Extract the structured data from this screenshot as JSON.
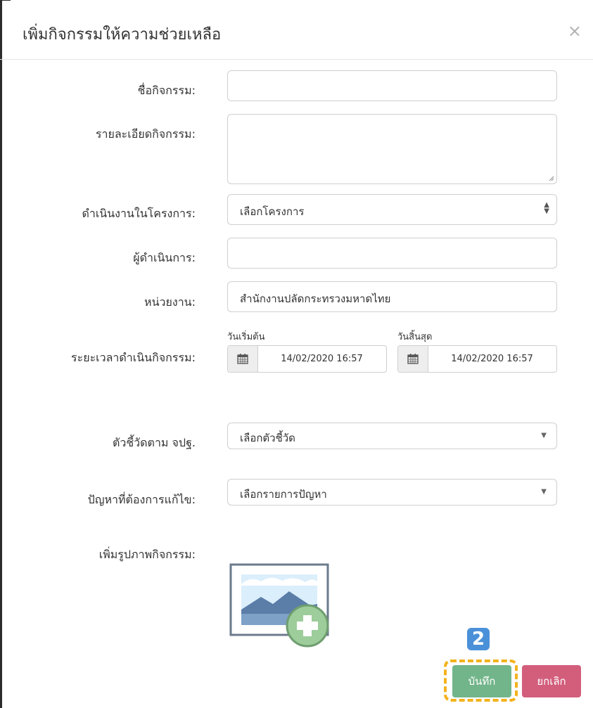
{
  "modal": {
    "title": "เพิ่มกิจกรรมให้ความช่วยเหลือ",
    "close_symbol": "×"
  },
  "form": {
    "activity_name": {
      "label": "ชื่อกิจกรรม:",
      "value": ""
    },
    "activity_detail": {
      "label": "รายละเอียดกิจกรรม:",
      "value": ""
    },
    "project": {
      "label": "ดำเนินงานในโครงการ:",
      "selected": "เลือกโครงการ"
    },
    "operator": {
      "label": "ผู้ดำเนินการ:",
      "value": ""
    },
    "agency": {
      "label": "หน่วยงาน:",
      "value": "สำนักงานปลัดกระทรวงมหาดไทย"
    },
    "period": {
      "label": "ระยะเวลาดำเนินกิจกรรม:",
      "start_label": "วันเริ่มต้น",
      "start_value": "14/02/2020 16:57",
      "end_label": "วันสิ้นสุด",
      "end_value": "14/02/2020 16:57"
    },
    "indicator": {
      "label": "ตัวชี้วัดตาม จปฐ.",
      "selected": "เลือกตัวชี้วัด"
    },
    "problem": {
      "label": "ปัญหาที่ต้องการแก้ไข:",
      "selected": "เลือกรายการปัญหา"
    },
    "image": {
      "label": "เพิ่มรูปภาพกิจกรรม:"
    }
  },
  "actions": {
    "step_badge": "2",
    "save_label": "บันทึก",
    "cancel_label": "ยกเลิก"
  },
  "colors": {
    "save": "#72b58a",
    "cancel": "#d25e7c",
    "highlight": "#f3b21b",
    "badge": "#4a90d9"
  }
}
